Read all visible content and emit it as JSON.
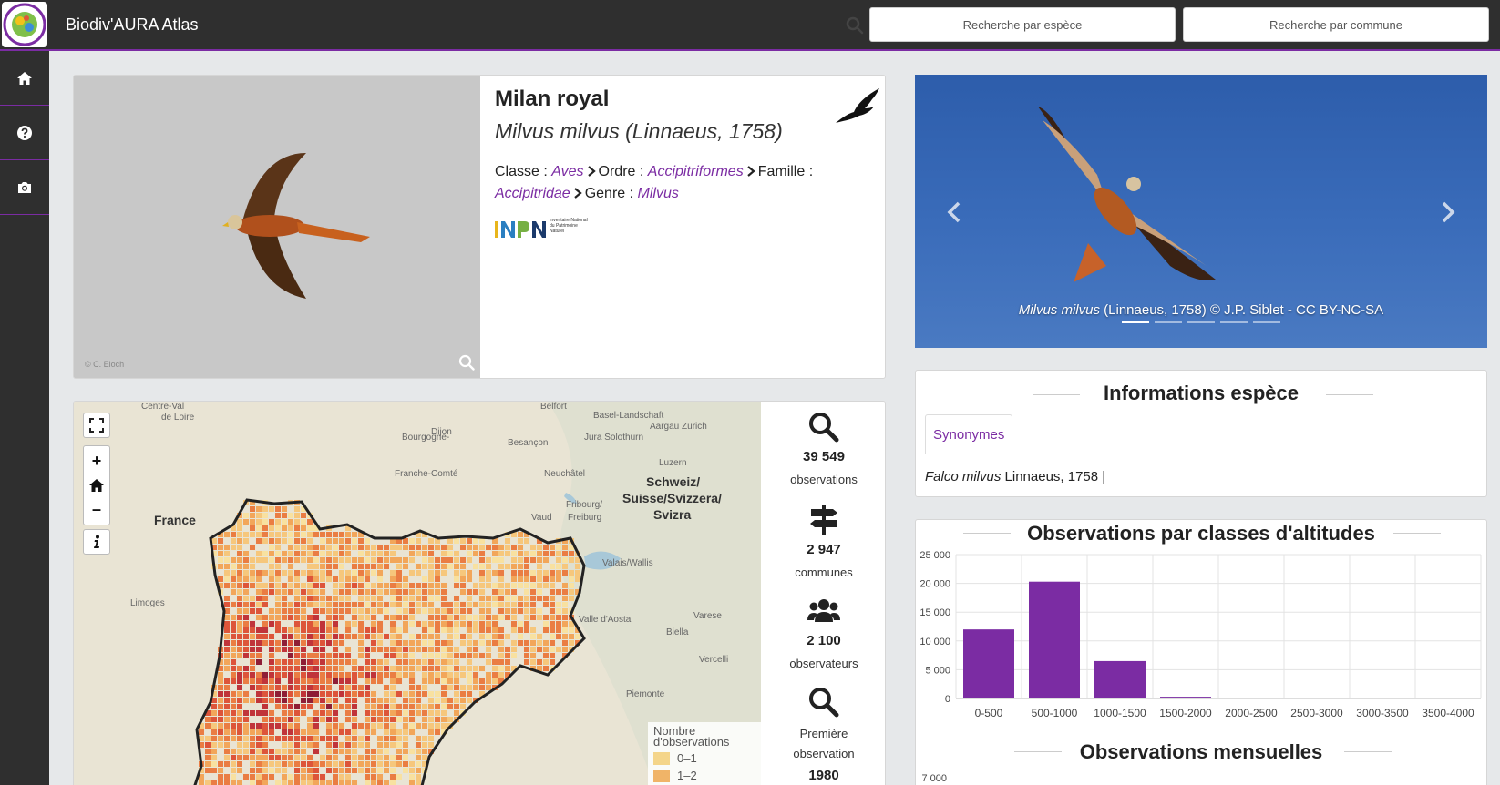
{
  "header": {
    "title": "Biodiv'AURA Atlas",
    "search_species": "Recherche par espèce",
    "search_commune": "Recherche par commune"
  },
  "sidebar": {
    "items": [
      {
        "icon": "home-icon"
      },
      {
        "icon": "help-icon"
      },
      {
        "icon": "camera-icon"
      }
    ]
  },
  "species": {
    "common_name": "Milan royal",
    "scientific_name": "Milvus milvus (Linnaeus, 1758)",
    "photo_credit": "© C. Eloch",
    "taxonomy": {
      "classe_label": "Classe :",
      "classe": "Aves",
      "ordre_label": "Ordre :",
      "ordre": "Accipitriformes",
      "famille_label": "Famille :",
      "famille": "Accipitridae",
      "genre_label": "Genre :",
      "genre": "Milvus"
    },
    "inpn_caption": "Inventaire National du Patrimoine Naturel"
  },
  "carousel": {
    "caption_italic": "Milvus milvus",
    "caption_rest": " (Linnaeus, 1758) © J.P. Siblet - CC BY-NC-SA",
    "slide_count": 5,
    "active_slide": 0
  },
  "map": {
    "labels": [
      {
        "text": "Centre-Val",
        "kind": "region"
      },
      {
        "text": "de Loire",
        "kind": "region"
      },
      {
        "text": "Belfort",
        "kind": "city"
      },
      {
        "text": "Basel-Landschaft",
        "kind": "region"
      },
      {
        "text": "Dijon",
        "kind": "city"
      },
      {
        "text": "Aargau Zürich",
        "kind": "region"
      },
      {
        "text": "Jura Solothurn",
        "kind": "region"
      },
      {
        "text": "Besançon",
        "kind": "city"
      },
      {
        "text": "Bourgogne-",
        "kind": "region"
      },
      {
        "text": "Franche-Comté",
        "kind": "region"
      },
      {
        "text": "Luzern",
        "kind": "region"
      },
      {
        "text": "Neuchâtel",
        "kind": "region"
      },
      {
        "text": "Schweiz/",
        "kind": "country"
      },
      {
        "text": "Suisse/Svizzera/",
        "kind": "country"
      },
      {
        "text": "Svizra",
        "kind": "country"
      },
      {
        "text": "France",
        "kind": "country"
      },
      {
        "text": "Fribourg/",
        "kind": "region"
      },
      {
        "text": "Freiburg",
        "kind": "region"
      },
      {
        "text": "Vaud",
        "kind": "region"
      },
      {
        "text": "Valais/Wallis",
        "kind": "region"
      },
      {
        "text": "Limoges",
        "kind": "city"
      },
      {
        "text": "Valle d'Aosta",
        "kind": "region"
      },
      {
        "text": "Varese",
        "kind": "city"
      },
      {
        "text": "Biella",
        "kind": "city"
      },
      {
        "text": "Vercelli",
        "kind": "city"
      },
      {
        "text": "Piemonte",
        "kind": "region"
      }
    ],
    "legend": {
      "title": "Nombre d'observations",
      "rows": [
        "0–1",
        "1–2"
      ]
    }
  },
  "stats": [
    {
      "icon": "search-icon",
      "value": "39 549",
      "label": "observations"
    },
    {
      "icon": "signpost-icon",
      "value": "2 947",
      "label": "communes"
    },
    {
      "icon": "users-icon",
      "value": "2 100",
      "label": "observateurs"
    },
    {
      "icon": "search-icon",
      "value": "1980",
      "label": "Première observation"
    }
  ],
  "info": {
    "title": "Informations espèce",
    "tab": "Synonymes",
    "synonym_italic": "Falco milvus",
    "synonym_rest": " Linnaeus, 1758 |"
  },
  "charts": {
    "altitude_title": "Observations par classes d'altitudes",
    "monthly_title": "Observations mensuelles",
    "monthly_first_tick": "7 000"
  },
  "chart_data": {
    "type": "bar",
    "title": "Observations par classes d'altitudes",
    "categories": [
      "0-500",
      "500-1000",
      "1000-1500",
      "1500-2000",
      "2000-2500",
      "2500-3000",
      "3000-3500",
      "3500-4000"
    ],
    "values": [
      12000,
      20300,
      6500,
      300,
      50,
      20,
      5,
      0
    ],
    "ylim": [
      0,
      25000
    ],
    "yticks": [
      "0",
      "5 000",
      "10 000",
      "15 000",
      "20 000",
      "25 000"
    ],
    "grid": true,
    "color": "#7b2ca3"
  },
  "colors": {
    "accent": "#7b2ca3",
    "topbar": "#2f2f2f"
  }
}
